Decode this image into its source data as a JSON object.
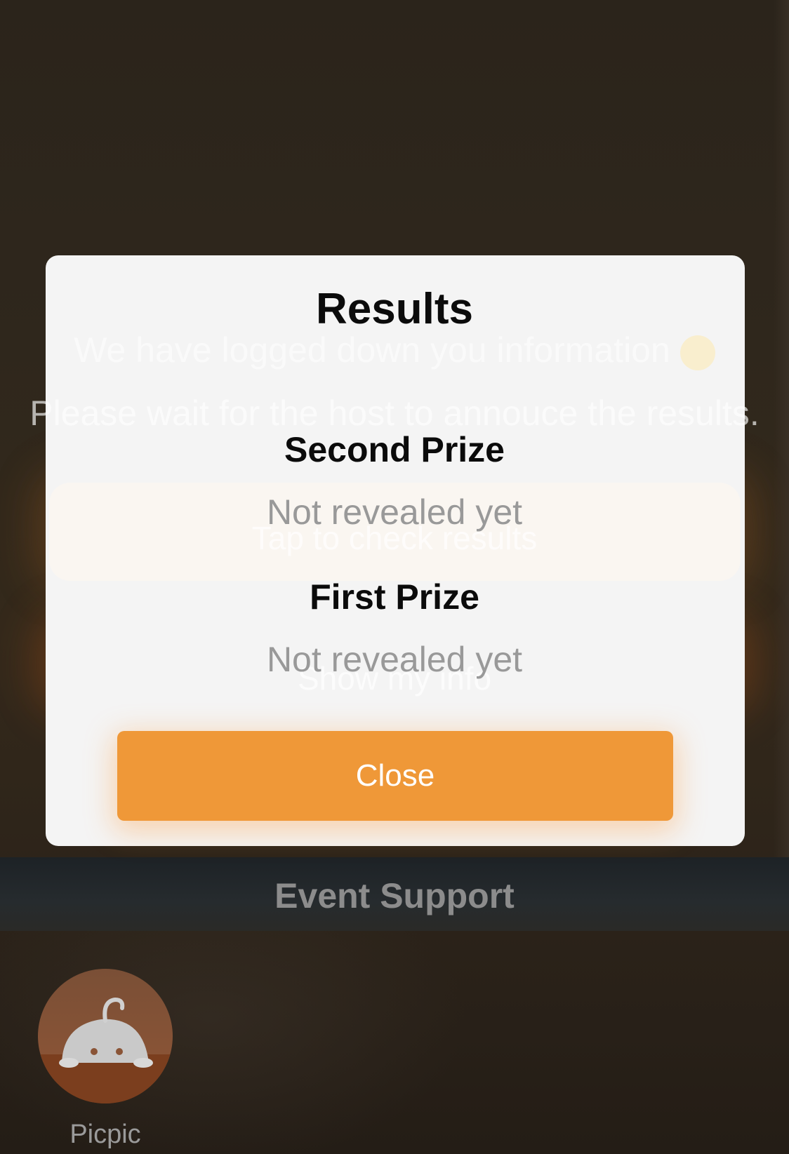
{
  "background": {
    "message_line1": "We have logged down you information",
    "message_line2": "Please wait for the host to annouce the results.",
    "check_results_button": "Tap to check results",
    "show_info_button": "Show my info",
    "support_title": "Event Support",
    "support_avatar_label": "Picpic"
  },
  "modal": {
    "title": "Results",
    "prizes": [
      {
        "label": "Second Prize",
        "value": "Not revealed yet"
      },
      {
        "label": "First Prize",
        "value": "Not revealed yet"
      }
    ],
    "close_label": "Close"
  },
  "colors": {
    "accent": "#ef9838",
    "modal_bg": "#f4f4f4",
    "muted_text": "#999999"
  }
}
